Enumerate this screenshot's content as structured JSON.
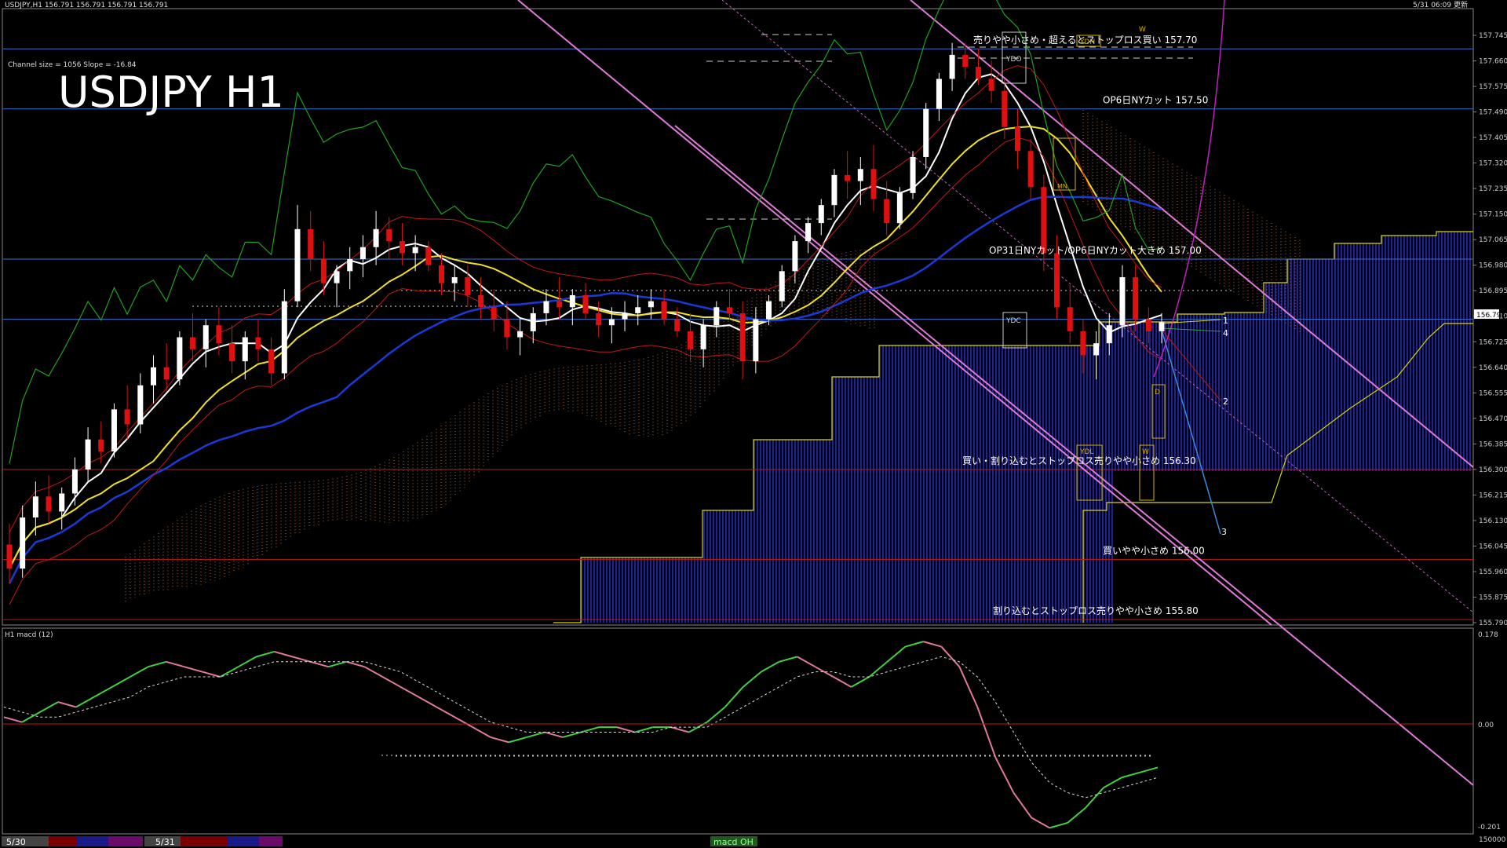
{
  "header": {
    "symbol_info": "USDJPY,H1  156.791 156.791 156.791 156.791",
    "datetime": "5/31 06:09 更新",
    "channel_info": "Channel size = 1056 Slope = -16.84",
    "big_title": "USDJPY H1"
  },
  "subwindow": {
    "label": "H1  macd (12)",
    "scale_top": "0.178",
    "scale_zero": "0.00",
    "scale_bottom": "-0.201",
    "right_corner": "150000"
  },
  "bottom_tabs": {
    "left_date": "5/30",
    "mid_date": "5/31",
    "macd_tab": "macd OH",
    "colors": [
      "#7a0000",
      "#1a1a8a",
      "#6a0a6a"
    ]
  },
  "price_lines": [
    {
      "price": 157.7,
      "label": "売りやや小さめ・超えるとストップロス買い 157.70",
      "color": "#3b6fd4"
    },
    {
      "price": 157.5,
      "label": "OP6日NYカット 157.50",
      "color": "#3b6fd4"
    },
    {
      "price": 157.0,
      "label": "OP31日NYカット/OP6日NYカット大きめ 157.00",
      "color": "#3b6fd4"
    },
    {
      "price": 156.8,
      "label": "",
      "color": "#3b6fd4"
    },
    {
      "price": 156.3,
      "label": "買い・割り込むとストップロス売りやや小さめ 156.30",
      "color": "#c01818"
    },
    {
      "price": 156.0,
      "label": "買いやや小さめ 156.00",
      "color": "#c01818"
    },
    {
      "price": 155.8,
      "label": "割り込むとストップロス売りやや小さめ 155.80",
      "color": "#c01818"
    }
  ],
  "markers": {
    "ydh": "YDH",
    "ydo": "YDO",
    "ydc": "YDC",
    "ydl": "YDL",
    "d": "D",
    "w": "W",
    "mn": "MN",
    "targets": [
      "1",
      "4",
      "2",
      "3"
    ]
  },
  "chart_data": {
    "type": "candlestick",
    "ylim": [
      155.79,
      157.745
    ],
    "y_ticks": [
      "157.745",
      "157.660",
      "157.575",
      "157.490",
      "157.405",
      "157.320",
      "157.235",
      "157.150",
      "157.065",
      "156.980",
      "156.895",
      "156.810",
      "156.725",
      "156.640",
      "156.555",
      "156.470",
      "156.385",
      "156.300",
      "156.215",
      "156.130",
      "156.045",
      "155.960",
      "155.875",
      "155.790"
    ],
    "current_price": "156.791",
    "candles": [
      [
        156.05,
        156.12,
        155.92,
        155.97
      ],
      [
        155.97,
        156.18,
        155.94,
        156.14
      ],
      [
        156.14,
        156.26,
        156.08,
        156.21
      ],
      [
        156.21,
        156.28,
        156.12,
        156.16
      ],
      [
        156.16,
        156.24,
        156.1,
        156.22
      ],
      [
        156.22,
        156.34,
        156.18,
        156.3
      ],
      [
        156.3,
        156.44,
        156.26,
        156.4
      ],
      [
        156.4,
        156.46,
        156.32,
        156.36
      ],
      [
        156.36,
        156.52,
        156.34,
        156.5
      ],
      [
        156.5,
        156.58,
        156.4,
        156.45
      ],
      [
        156.45,
        156.62,
        156.42,
        156.58
      ],
      [
        156.58,
        156.68,
        156.52,
        156.64
      ],
      [
        156.64,
        156.72,
        156.56,
        156.6
      ],
      [
        156.6,
        156.76,
        156.58,
        156.74
      ],
      [
        156.74,
        156.82,
        156.66,
        156.7
      ],
      [
        156.7,
        156.8,
        156.64,
        156.78
      ],
      [
        156.78,
        156.84,
        156.68,
        156.72
      ],
      [
        156.72,
        156.78,
        156.62,
        156.66
      ],
      [
        156.66,
        156.76,
        156.6,
        156.74
      ],
      [
        156.74,
        156.8,
        156.66,
        156.7
      ],
      [
        156.7,
        156.74,
        156.58,
        156.62
      ],
      [
        156.62,
        156.9,
        156.6,
        156.86
      ],
      [
        156.86,
        157.18,
        156.84,
        157.1
      ],
      [
        157.1,
        157.16,
        156.96,
        157.0
      ],
      [
        157.0,
        157.06,
        156.88,
        156.92
      ],
      [
        156.92,
        156.98,
        156.84,
        156.96
      ],
      [
        156.96,
        157.04,
        156.9,
        157.0
      ],
      [
        157.0,
        157.08,
        156.94,
        157.04
      ],
      [
        157.04,
        157.16,
        156.98,
        157.1
      ],
      [
        157.1,
        157.14,
        157.0,
        157.06
      ],
      [
        157.06,
        157.12,
        156.98,
        157.02
      ],
      [
        157.02,
        157.08,
        156.96,
        157.04
      ],
      [
        157.04,
        157.06,
        156.96,
        156.98
      ],
      [
        156.98,
        157.02,
        156.88,
        156.92
      ],
      [
        156.92,
        156.98,
        156.86,
        156.94
      ],
      [
        156.94,
        156.98,
        156.84,
        156.88
      ],
      [
        156.88,
        156.94,
        156.8,
        156.84
      ],
      [
        156.84,
        156.9,
        156.76,
        156.8
      ],
      [
        156.8,
        156.86,
        156.7,
        156.74
      ],
      [
        156.74,
        156.8,
        156.68,
        156.76
      ],
      [
        156.76,
        156.84,
        156.72,
        156.82
      ],
      [
        156.82,
        156.9,
        156.78,
        156.86
      ],
      [
        156.86,
        156.94,
        156.8,
        156.84
      ],
      [
        156.84,
        156.9,
        156.78,
        156.88
      ],
      [
        156.88,
        156.92,
        156.8,
        156.82
      ],
      [
        156.82,
        156.86,
        156.74,
        156.78
      ],
      [
        156.78,
        156.84,
        156.72,
        156.8
      ],
      [
        156.8,
        156.86,
        156.76,
        156.82
      ],
      [
        156.82,
        156.88,
        156.78,
        156.84
      ],
      [
        156.84,
        156.9,
        156.8,
        156.86
      ],
      [
        156.86,
        156.9,
        156.78,
        156.8
      ],
      [
        156.8,
        156.84,
        156.74,
        156.76
      ],
      [
        156.76,
        156.82,
        156.66,
        156.7
      ],
      [
        156.7,
        156.8,
        156.64,
        156.78
      ],
      [
        156.78,
        156.86,
        156.74,
        156.84
      ],
      [
        156.84,
        156.9,
        156.8,
        156.82
      ],
      [
        156.82,
        156.86,
        156.6,
        156.66
      ],
      [
        156.66,
        156.84,
        156.62,
        156.8
      ],
      [
        156.8,
        156.88,
        156.78,
        156.86
      ],
      [
        156.86,
        156.98,
        156.84,
        156.96
      ],
      [
        156.96,
        157.08,
        156.92,
        157.06
      ],
      [
        157.06,
        157.14,
        157.02,
        157.12
      ],
      [
        157.12,
        157.2,
        157.08,
        157.18
      ],
      [
        157.18,
        157.3,
        157.14,
        157.28
      ],
      [
        157.28,
        157.36,
        157.2,
        157.26
      ],
      [
        157.26,
        157.34,
        157.18,
        157.3
      ],
      [
        157.3,
        157.38,
        157.16,
        157.2
      ],
      [
        157.2,
        157.26,
        157.08,
        157.12
      ],
      [
        157.12,
        157.24,
        157.1,
        157.22
      ],
      [
        157.22,
        157.36,
        157.2,
        157.34
      ],
      [
        157.34,
        157.52,
        157.3,
        157.5
      ],
      [
        157.5,
        157.62,
        157.46,
        157.6
      ],
      [
        157.6,
        157.72,
        157.56,
        157.68
      ],
      [
        157.68,
        157.72,
        157.6,
        157.64
      ],
      [
        157.64,
        157.7,
        157.58,
        157.6
      ],
      [
        157.6,
        157.66,
        157.52,
        157.56
      ],
      [
        157.56,
        157.6,
        157.4,
        157.44
      ],
      [
        157.44,
        157.5,
        157.3,
        157.36
      ],
      [
        157.36,
        157.4,
        157.2,
        157.24
      ],
      [
        157.24,
        157.28,
        156.96,
        157.02
      ],
      [
        157.02,
        157.08,
        156.8,
        156.84
      ],
      [
        156.84,
        156.92,
        156.72,
        156.76
      ],
      [
        156.76,
        156.8,
        156.62,
        156.68
      ],
      [
        156.68,
        156.76,
        156.6,
        156.72
      ],
      [
        156.72,
        156.82,
        156.68,
        156.78
      ],
      [
        156.78,
        156.98,
        156.74,
        156.94
      ],
      [
        156.94,
        156.98,
        156.76,
        156.8
      ],
      [
        156.8,
        156.84,
        156.72,
        156.76
      ],
      [
        156.76,
        156.82,
        156.72,
        156.79
      ]
    ],
    "macd": [
      0.02,
      0.01,
      0.03,
      0.05,
      0.04,
      0.06,
      0.08,
      0.1,
      0.12,
      0.13,
      0.12,
      0.11,
      0.1,
      0.12,
      0.14,
      0.15,
      0.14,
      0.13,
      0.12,
      0.13,
      0.12,
      0.1,
      0.08,
      0.06,
      0.04,
      0.02,
      0.0,
      -0.02,
      -0.03,
      -0.02,
      -0.01,
      -0.02,
      -0.01,
      0.0,
      0.0,
      -0.01,
      0.0,
      0.0,
      -0.01,
      0.01,
      0.04,
      0.08,
      0.11,
      0.13,
      0.14,
      0.12,
      0.1,
      0.08,
      0.1,
      0.13,
      0.16,
      0.17,
      0.16,
      0.12,
      0.04,
      -0.06,
      -0.13,
      -0.18,
      -0.2,
      -0.19,
      -0.16,
      -0.12,
      -0.1,
      -0.09,
      -0.08
    ],
    "signal": [
      0.04,
      0.03,
      0.02,
      0.02,
      0.03,
      0.04,
      0.05,
      0.06,
      0.08,
      0.09,
      0.1,
      0.1,
      0.1,
      0.11,
      0.12,
      0.13,
      0.13,
      0.13,
      0.13,
      0.13,
      0.13,
      0.12,
      0.11,
      0.09,
      0.07,
      0.05,
      0.03,
      0.01,
      0.0,
      -0.01,
      -0.01,
      -0.01,
      -0.01,
      -0.01,
      -0.01,
      -0.01,
      -0.01,
      0.0,
      0.0,
      0.0,
      0.02,
      0.04,
      0.06,
      0.08,
      0.1,
      0.11,
      0.11,
      0.1,
      0.1,
      0.11,
      0.12,
      0.13,
      0.14,
      0.13,
      0.1,
      0.05,
      -0.01,
      -0.07,
      -0.11,
      -0.13,
      -0.14,
      -0.13,
      -0.12,
      -0.11,
      -0.1
    ]
  }
}
